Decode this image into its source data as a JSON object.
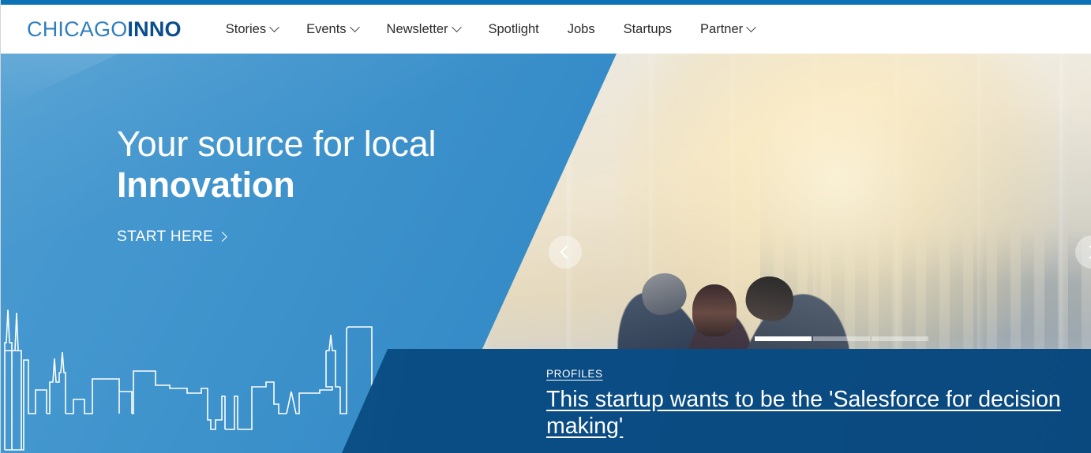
{
  "header": {
    "logo": {
      "primary": "CHICAGO",
      "secondary": "INNO",
      "primary_color": "#2f7fbf",
      "secondary_color": "#0a4d8c"
    },
    "nav": [
      {
        "label": "Stories",
        "has_dropdown": true
      },
      {
        "label": "Events",
        "has_dropdown": true
      },
      {
        "label": "Newsletter",
        "has_dropdown": true
      },
      {
        "label": "Spotlight",
        "has_dropdown": false
      },
      {
        "label": "Jobs",
        "has_dropdown": false
      },
      {
        "label": "Startups",
        "has_dropdown": false
      },
      {
        "label": "Partner",
        "has_dropdown": true
      }
    ]
  },
  "hero": {
    "title_line1": "Your source for local",
    "title_line2": "Innovation",
    "cta_label": "START HERE",
    "accent_color": "#0b72b5",
    "panel_color": "#2f87c4",
    "overlay_color": "#0a4d85"
  },
  "carousel": {
    "prev_label": "Previous slide",
    "next_label": "Next slide",
    "slides_total": 3,
    "active_slide": 1
  },
  "featured": {
    "kicker": "PROFILES",
    "headline": "This startup wants to be the 'Salesforce for decision making'"
  }
}
